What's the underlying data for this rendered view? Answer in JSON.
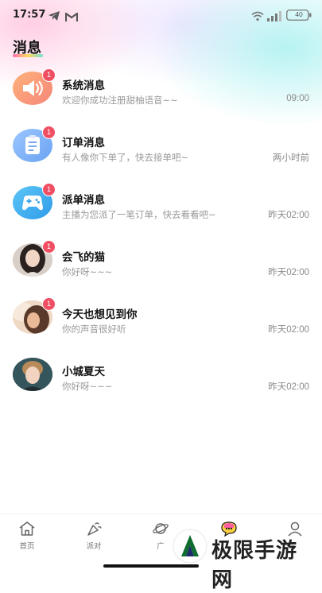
{
  "status_bar": {
    "time": "17:57",
    "battery": "40"
  },
  "page": {
    "title": "消息"
  },
  "messages": [
    {
      "name": "系统消息",
      "preview": "欢迎你成功注册甜柚语音~~",
      "time": "09:00",
      "badge": "1",
      "avatar_icon": "speaker-icon"
    },
    {
      "name": "订单消息",
      "preview": "有人像你下单了，快去接单吧~",
      "time": "两小时前",
      "badge": "1",
      "avatar_icon": "clipboard-icon"
    },
    {
      "name": "派单消息",
      "preview": "主播为您派了一笔订单，快去看看吧~",
      "time": "昨天02:00",
      "badge": "1",
      "avatar_icon": "gamepad-icon"
    },
    {
      "name": "会飞的猫",
      "preview": "你好呀~~~",
      "time": "昨天02:00",
      "badge": "1",
      "avatar_icon": "user-photo"
    },
    {
      "name": "今天也想见到你",
      "preview": "你的声音很好听",
      "time": "昨天02:00",
      "badge": "1",
      "avatar_icon": "user-photo"
    },
    {
      "name": "小城夏天",
      "preview": "你好呀~~~",
      "time": "昨天02:00",
      "badge": "",
      "avatar_icon": "user-photo"
    }
  ],
  "tabbar": {
    "items": [
      {
        "label": "首页",
        "icon": "home-icon"
      },
      {
        "label": "派对",
        "icon": "party-icon"
      },
      {
        "label": "广",
        "icon": "planet-icon"
      },
      {
        "label": "",
        "icon": "message-icon"
      },
      {
        "label": "",
        "icon": "profile-icon"
      }
    ]
  },
  "watermark": {
    "text": "极限手游网"
  },
  "colors": {
    "badge": "#f04f63",
    "system_avatar": "#f7a36a",
    "order_avatar": "#7fb3f5",
    "dispatch_avatar": "#47b3f0"
  }
}
